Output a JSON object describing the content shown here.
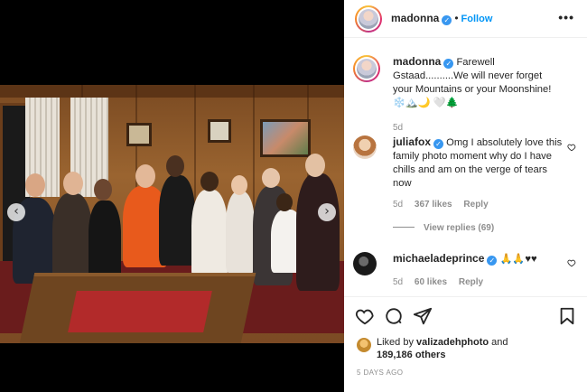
{
  "post": {
    "author": "madonna",
    "follow_label": "Follow",
    "separator": "•",
    "more_label": "•••",
    "caption_prefix": "Farewell Gstaad..........We will never forget your Mountains or your Moonshine!",
    "caption_emojis": "❄️🏔️🌙 🤍🌲",
    "caption_age": "5d",
    "nav_prev": "‹",
    "nav_next": "›"
  },
  "comments": [
    {
      "username": "juliafox",
      "text": "Omg I absolutely love this family photo moment why do I have chills and am on the verge of tears now",
      "age": "5d",
      "likes": "367 likes",
      "reply_label": "Reply",
      "view_replies": "View replies (69)"
    },
    {
      "username": "michaeladeprince",
      "text": "🙏🙏♥♥",
      "age": "5d",
      "likes": "60 likes",
      "reply_label": "Reply"
    }
  ],
  "likes": {
    "prefix": "Liked by",
    "user": "valizadehphoto",
    "and": "and",
    "count": "189,186 others"
  },
  "timestamp": "5 DAYS AGO",
  "icons": {
    "verified": "verified-badge-icon",
    "like": "heart-icon",
    "comment": "comment-icon",
    "share": "paper-plane-icon",
    "save": "bookmark-icon",
    "more": "more-options-icon"
  },
  "colors": {
    "follow": "#0095f6",
    "verified": "#3897f0",
    "muted": "#8e8e8e",
    "text": "#262626"
  }
}
